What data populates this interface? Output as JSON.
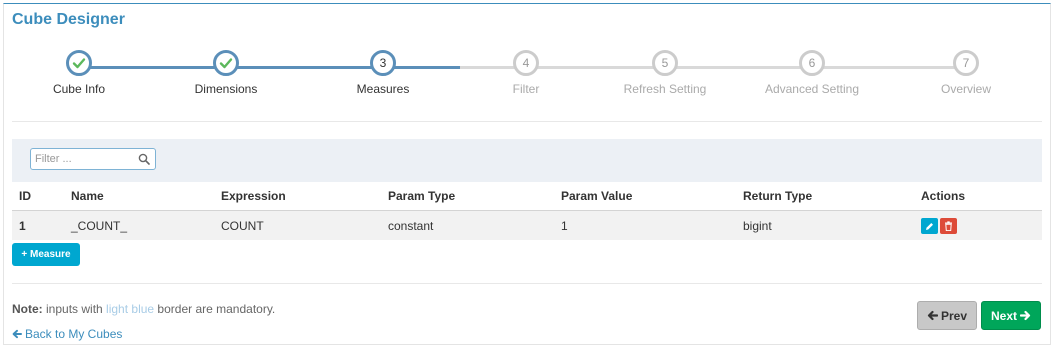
{
  "title": "Cube Designer",
  "accent": "#3c8dbc",
  "wizard": {
    "current_step": 3,
    "steps": [
      {
        "number": "",
        "label": "Cube Info",
        "state": "done",
        "icon": "check-icon"
      },
      {
        "number": "",
        "label": "Dimensions",
        "state": "done",
        "icon": "check-icon"
      },
      {
        "number": "3",
        "label": "Measures",
        "state": "current"
      },
      {
        "number": "4",
        "label": "Filter",
        "state": "pending"
      },
      {
        "number": "5",
        "label": "Refresh Setting",
        "state": "pending"
      },
      {
        "number": "6",
        "label": "Advanced Setting",
        "state": "pending"
      },
      {
        "number": "7",
        "label": "Overview",
        "state": "pending"
      }
    ]
  },
  "filter": {
    "placeholder": "Filter ...",
    "value": "",
    "icon": "search-icon"
  },
  "table": {
    "headers": [
      "ID",
      "Name",
      "Expression",
      "Param Type",
      "Param Value",
      "Return Type",
      "Actions"
    ],
    "rows": [
      {
        "id": "1",
        "name": "_COUNT_",
        "expression": "COUNT",
        "param_type": "constant",
        "param_value": "1",
        "return_type": "bigint",
        "actions": [
          "pencil-icon",
          "trash-icon"
        ]
      }
    ]
  },
  "add_measure_label": "+ Measure",
  "note": {
    "prefix": "Note:",
    "text1": " inputs with ",
    "highlight": "light blue",
    "text2": " border are mandatory."
  },
  "back_label": "Back to My Cubes",
  "prev_label": "Prev",
  "next_label": "Next",
  "colors": {
    "done": "#5b8fb9",
    "check": "#5cb85c",
    "pending": "#cccccc",
    "info_button": "#00a7d0",
    "danger_button": "#dd4b39",
    "success_button": "#00a65a"
  }
}
